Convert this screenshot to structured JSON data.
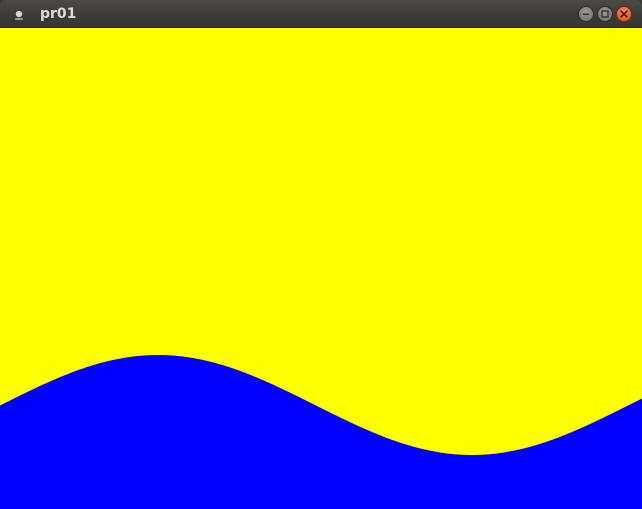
{
  "window": {
    "title": "pr01",
    "icon": "app-icon",
    "controls": {
      "minimize_icon": "minimize-icon",
      "maximize_icon": "maximize-icon",
      "close_icon": "close-icon"
    }
  },
  "canvas": {
    "background_color": "#ffff00",
    "wave_color": "#0000ff"
  }
}
